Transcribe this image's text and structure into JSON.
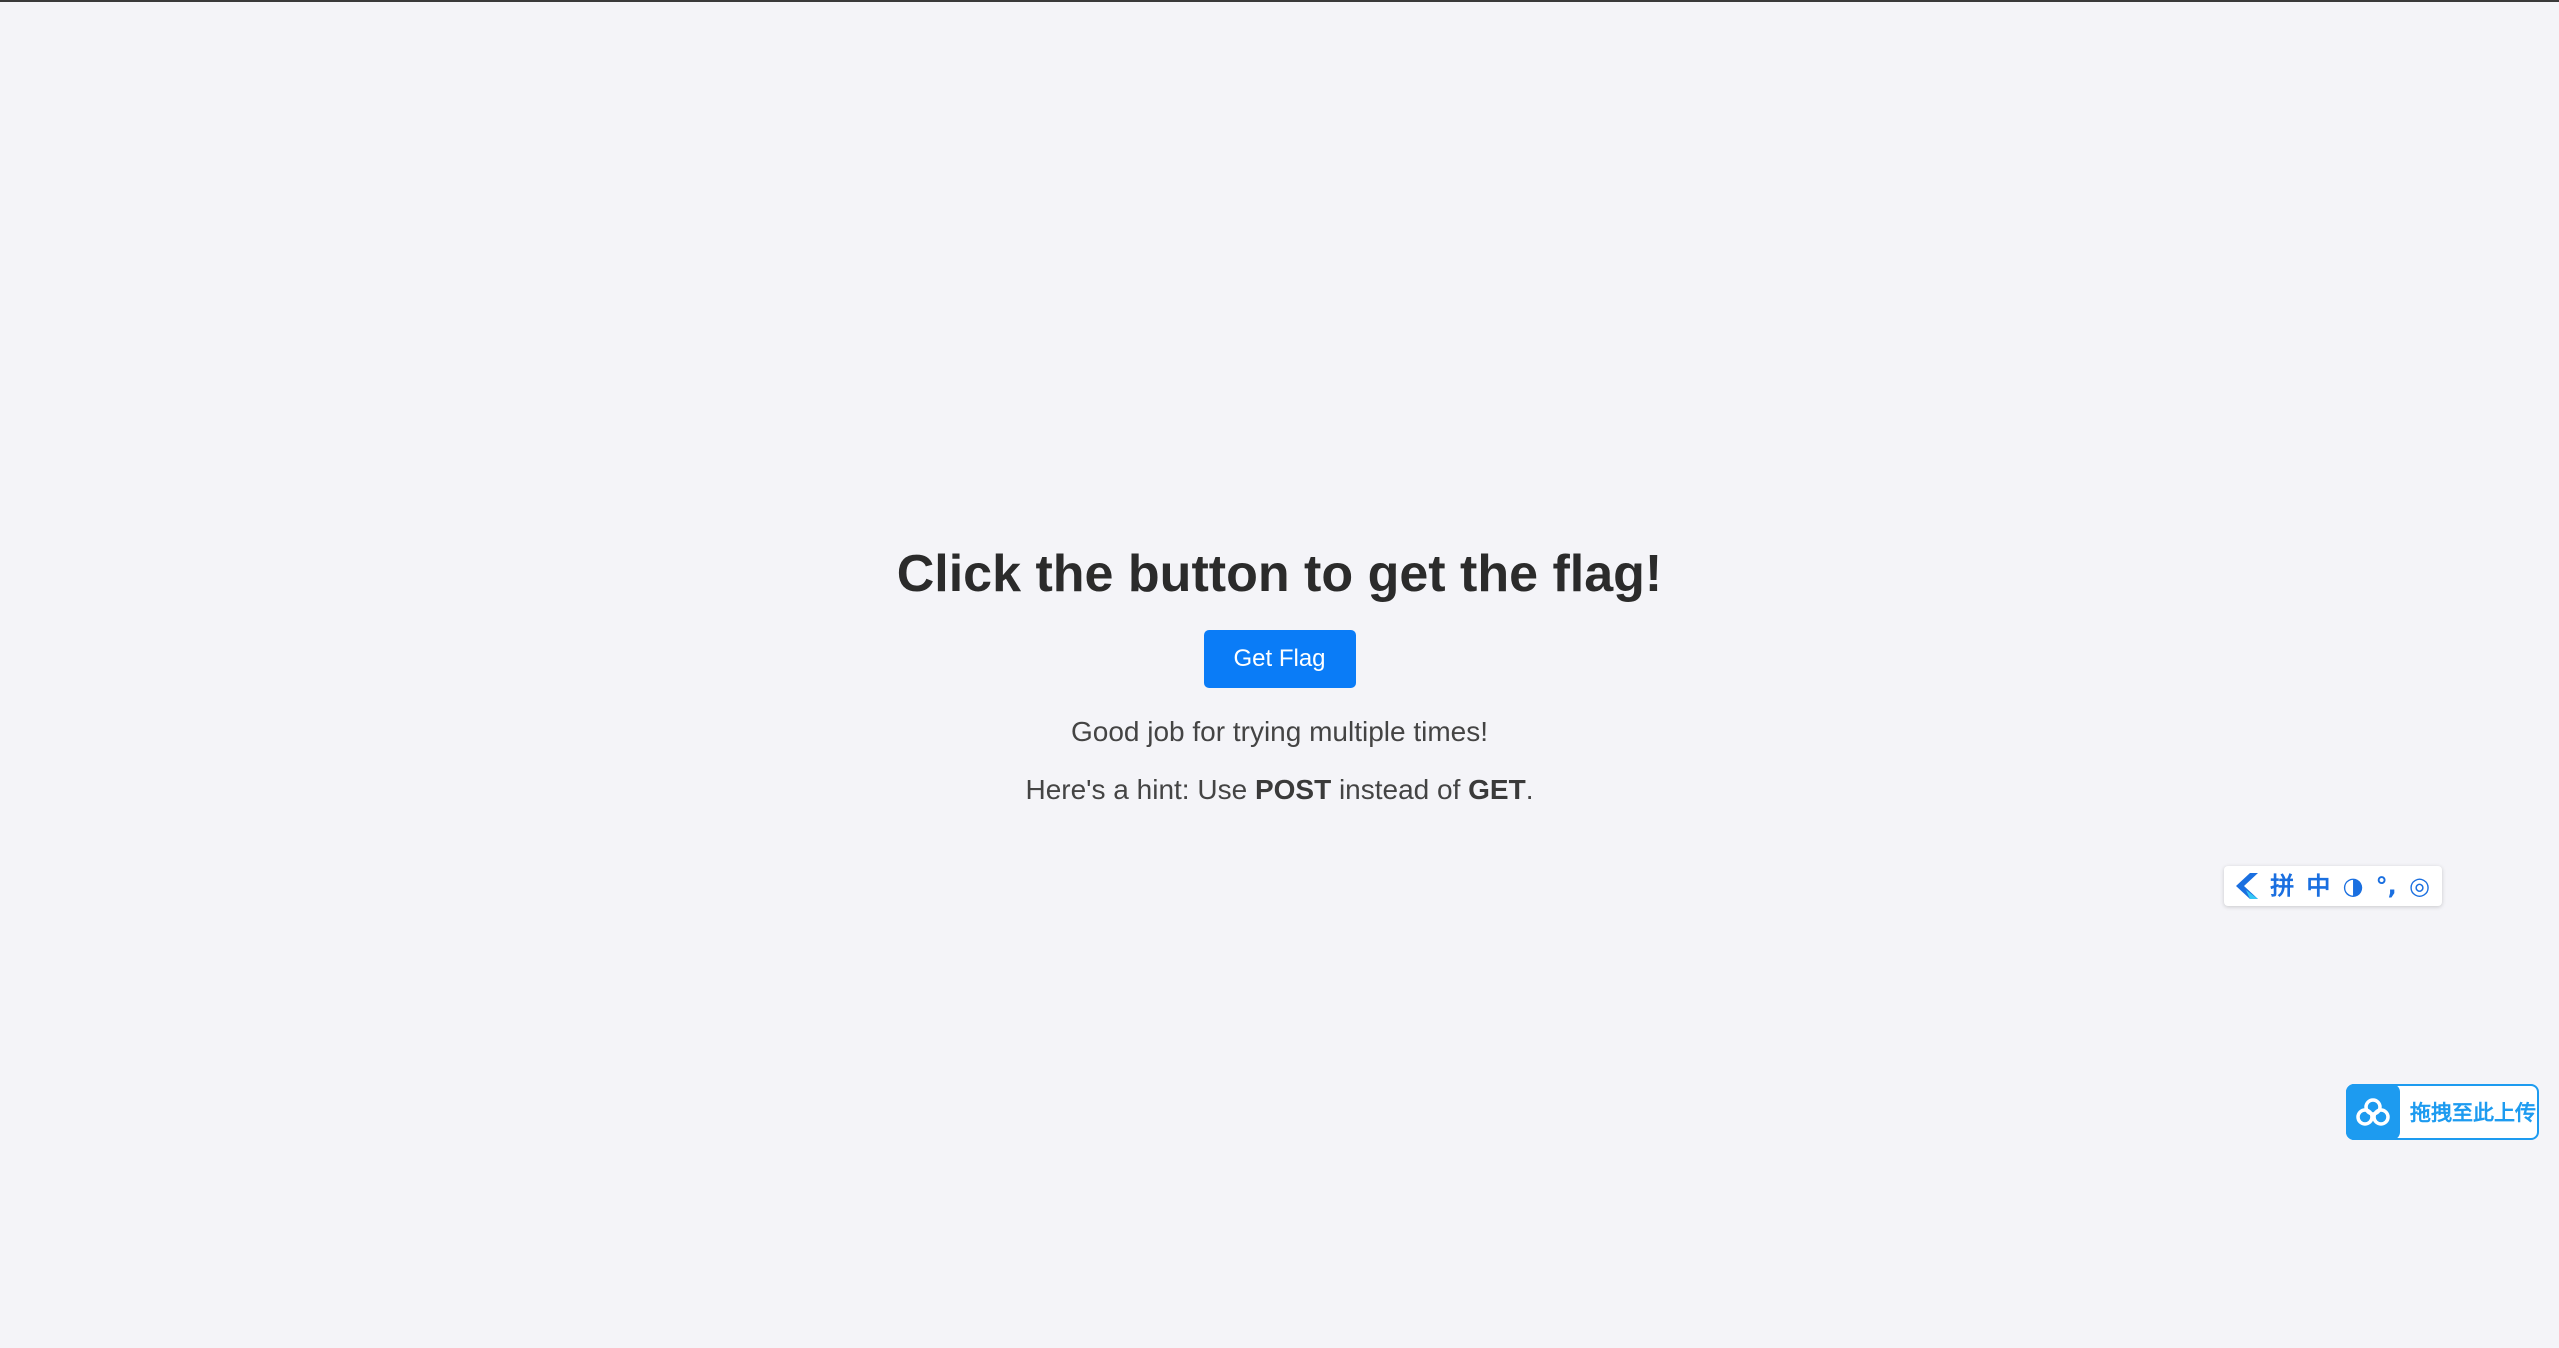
{
  "page": {
    "title": "Click the button to get the flag!",
    "button_label": "Get Flag",
    "message": "Good job for trying multiple times!",
    "hint": {
      "prefix": "Here's a hint: Use ",
      "method_a": "POST",
      "middle": " instead of ",
      "method_b": "GET",
      "suffix": "."
    }
  },
  "ime_toolbar": {
    "logo_icon": "ime-logo-icon",
    "items": [
      {
        "label": "拼",
        "icon": "pinyin-mode-icon"
      },
      {
        "label": "中",
        "icon": "chinese-mode-icon"
      },
      {
        "label": "◑",
        "icon": "half-width-icon"
      },
      {
        "label": "°,",
        "icon": "punctuation-icon"
      },
      {
        "label": "◎",
        "icon": "settings-icon"
      }
    ]
  },
  "upload_widget": {
    "icon": "cloud-upload-icon",
    "label": "拖拽至此上传"
  },
  "colors": {
    "background": "#f4f4f8",
    "button": "#0a7cf7",
    "upload_accent": "#1d9bf0",
    "ime_accent": "#1a6fe0"
  }
}
